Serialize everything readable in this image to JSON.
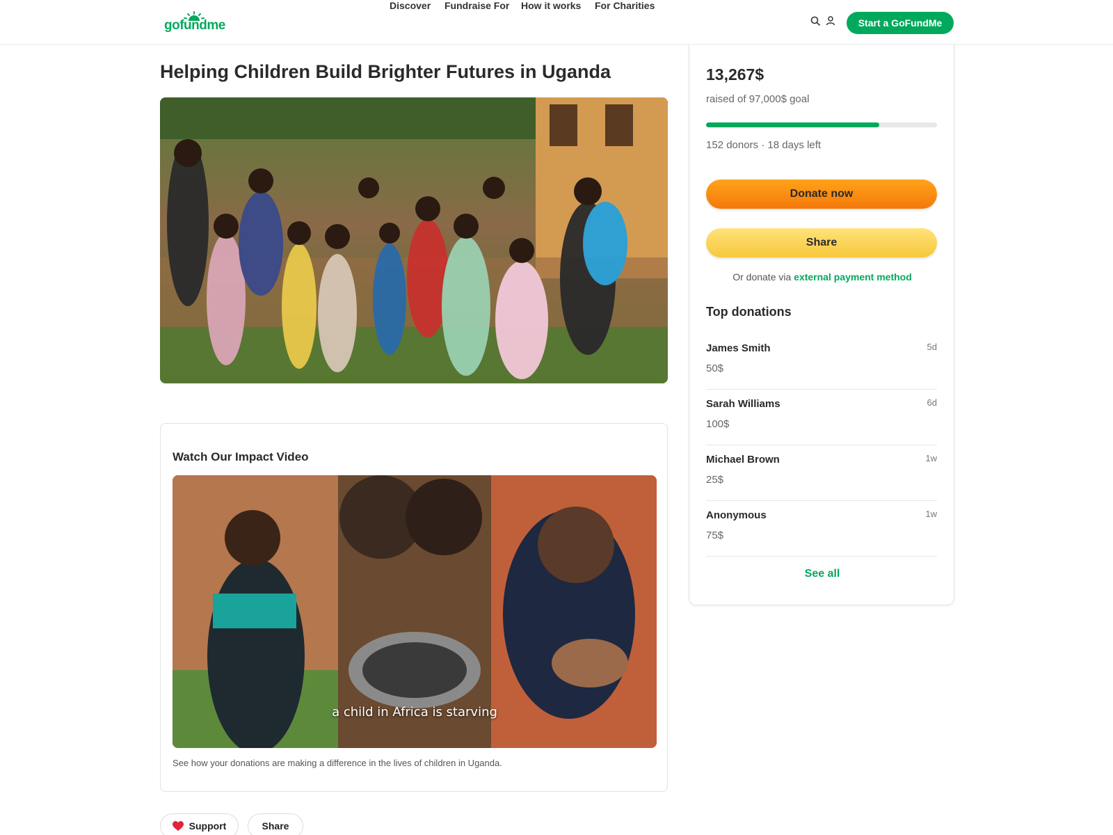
{
  "brand": {
    "name": "gofundme",
    "color": "#02a95c"
  },
  "nav": {
    "items": [
      "Discover",
      "Fundraise For",
      "How it works",
      "For Charities"
    ],
    "search_icon": "search-icon",
    "user_icon": "user-icon",
    "cta": "Start a GoFundMe"
  },
  "campaign": {
    "title": "Helping Children Build Brighter Futures in Uganda",
    "hero_image": "photo of a group of children standing outdoors"
  },
  "video": {
    "heading": "Watch Our Impact Video",
    "caption": "a child in Africa is starving",
    "description": "See how your donations are making a difference in the lives of children in Uganda."
  },
  "actions": {
    "support_label": "Support",
    "support_icon": "heart-icon",
    "share_label": "Share"
  },
  "sidebar": {
    "raised": "13,267$",
    "goal_text": "raised of 97,000$ goal",
    "progress_fraction": 0.75,
    "stats": "152 donors · 18 days left",
    "donate_label": "Donate now",
    "share_label": "Share",
    "alt_prefix": "Or donate via ",
    "alt_link": "external payment method",
    "top_heading": "Top donations",
    "donations": [
      {
        "name": "James Smith",
        "amount": "50$",
        "time": "5d"
      },
      {
        "name": "Sarah Williams",
        "amount": "100$",
        "time": "6d"
      },
      {
        "name": "Michael Brown",
        "amount": "25$",
        "time": "1w"
      },
      {
        "name": "Anonymous",
        "amount": "75$",
        "time": "1w"
      }
    ],
    "see_all": "See all"
  }
}
